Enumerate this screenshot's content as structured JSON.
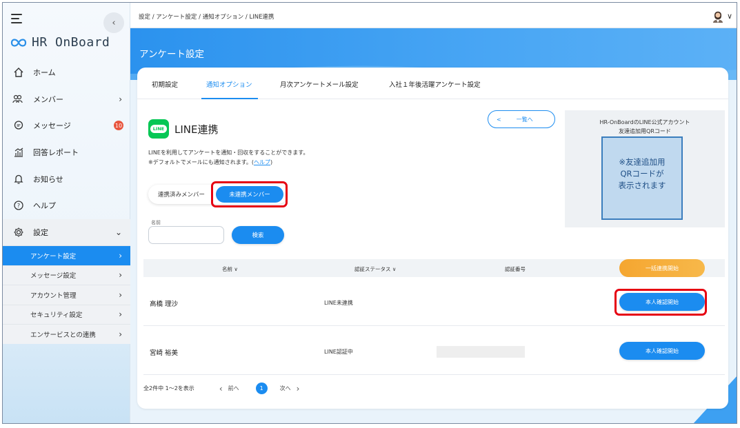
{
  "sidebar": {
    "logo_text": "HR OnBoard",
    "collapse_glyph": "‹",
    "items": [
      {
        "label": "ホーム",
        "icon": "home-icon"
      },
      {
        "label": "メンバー",
        "icon": "members-icon"
      },
      {
        "label": "メッセージ",
        "icon": "message-icon",
        "badge": "10"
      },
      {
        "label": "回答レポート",
        "icon": "report-icon"
      },
      {
        "label": "お知らせ",
        "icon": "bell-icon"
      },
      {
        "label": "ヘルプ",
        "icon": "help-icon"
      },
      {
        "label": "設定",
        "icon": "gear-icon"
      }
    ],
    "sub_items": [
      {
        "label": "アンケート設定",
        "active": true
      },
      {
        "label": "メッセージ設定"
      },
      {
        "label": "アカウント管理"
      },
      {
        "label": "セキュリティ設定"
      },
      {
        "label": "エンサービスとの連携"
      }
    ]
  },
  "topbar": {
    "breadcrumb": "設定 / アンケート設定 / 通知オプション / LINE連携"
  },
  "header": {
    "title": "アンケート設定"
  },
  "tabs": [
    {
      "label": "初期設定"
    },
    {
      "label": "通知オプション",
      "active": true
    },
    {
      "label": "月次アンケートメール設定"
    },
    {
      "label": "入社１年後活躍アンケート設定"
    }
  ],
  "line": {
    "logo_text": "LINE",
    "title": "LINE連携",
    "desc_line1": "LINEを利用してアンケートを通知・回収をすることができます。",
    "desc_line2_prefix": "※デフォルトでメールにも通知されます。(",
    "help_link": "ヘルプ",
    "desc_line2_suffix": ")"
  },
  "back_button": {
    "arrow": "<",
    "label": "一覧へ"
  },
  "qr": {
    "caption_line1": "HR-OnBoardのLINE公式アカウント",
    "caption_line2": "友達追加用QRコード",
    "placeholder_line1": "※友達追加用",
    "placeholder_line2": "QRコードが",
    "placeholder_line3": "表示されます"
  },
  "toggle": {
    "linked": "連携済みメンバー",
    "unlinked": "未連携メンバー"
  },
  "search": {
    "label": "名前",
    "value": "",
    "button": "検索"
  },
  "table": {
    "headers": {
      "name": "名前",
      "status": "認証ステータス",
      "code": "認証番号"
    },
    "sort_glyph": "∨",
    "bulk_button": "一括連携開始",
    "rows": [
      {
        "name": "高橋 理沙",
        "status": "LINE未連携",
        "action": "本人確認開始"
      },
      {
        "name": "宮崎 裕美",
        "status": "LINE認証中",
        "action": "本人確認開始"
      }
    ]
  },
  "pagination": {
    "summary": "全2件中 1〜2を表示",
    "prev": "前へ",
    "current": "1",
    "next": "次へ"
  },
  "colors": {
    "accent": "#1b8cf0",
    "orange": "#f5a630",
    "highlight": "#e60012",
    "line_green": "#06c755"
  }
}
